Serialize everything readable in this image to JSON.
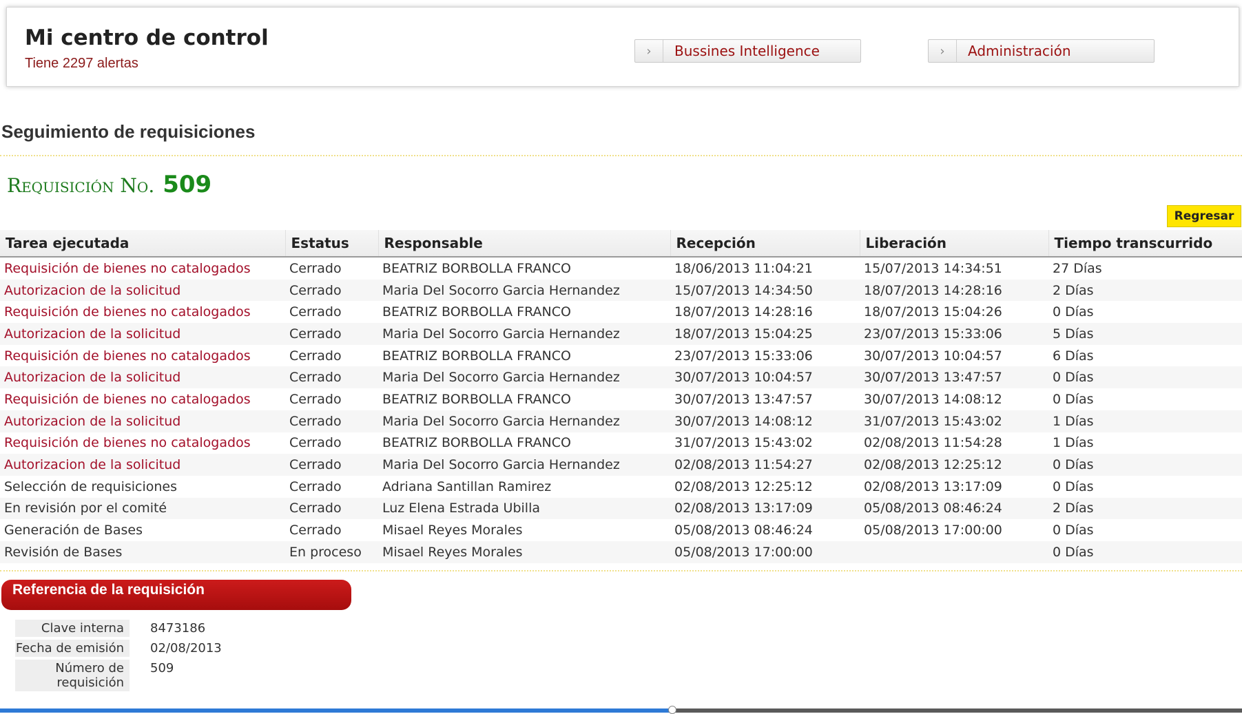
{
  "header": {
    "title": "Mi centro de control",
    "alerts": "Tiene 2297 alertas",
    "nav": [
      {
        "label": "Bussines Intelligence"
      },
      {
        "label": "Administración"
      }
    ]
  },
  "section": {
    "title": "Seguimiento de requisiciones"
  },
  "requisition": {
    "label": "Requisición No.",
    "number": "509",
    "back_label": "Regresar"
  },
  "table": {
    "columns": [
      "Tarea ejecutada",
      "Estatus",
      "Responsable",
      "Recepción",
      "Liberación",
      "Tiempo transcurrido"
    ],
    "rows": [
      {
        "task": "Requisición de bienes no catalogados",
        "link": true,
        "status": "Cerrado",
        "owner": "BEATRIZ BORBOLLA FRANCO",
        "received": "18/06/2013 11:04:21",
        "released": "15/07/2013 14:34:51",
        "elapsed": "27 Días"
      },
      {
        "task": "Autorizacion de la solicitud",
        "link": true,
        "status": "Cerrado",
        "owner": "Maria Del Socorro Garcia Hernandez",
        "received": "15/07/2013 14:34:50",
        "released": "18/07/2013 14:28:16",
        "elapsed": "2 Días"
      },
      {
        "task": "Requisición de bienes no catalogados",
        "link": true,
        "status": "Cerrado",
        "owner": "BEATRIZ BORBOLLA FRANCO",
        "received": "18/07/2013 14:28:16",
        "released": "18/07/2013 15:04:26",
        "elapsed": "0 Días"
      },
      {
        "task": "Autorizacion de la solicitud",
        "link": true,
        "status": "Cerrado",
        "owner": "Maria Del Socorro Garcia Hernandez",
        "received": "18/07/2013 15:04:25",
        "released": "23/07/2013 15:33:06",
        "elapsed": "5 Días"
      },
      {
        "task": "Requisición de bienes no catalogados",
        "link": true,
        "status": "Cerrado",
        "owner": "BEATRIZ BORBOLLA FRANCO",
        "received": "23/07/2013 15:33:06",
        "released": "30/07/2013 10:04:57",
        "elapsed": "6 Días"
      },
      {
        "task": "Autorizacion de la solicitud",
        "link": true,
        "status": "Cerrado",
        "owner": "Maria Del Socorro Garcia Hernandez",
        "received": "30/07/2013 10:04:57",
        "released": "30/07/2013 13:47:57",
        "elapsed": "0 Días"
      },
      {
        "task": "Requisición de bienes no catalogados",
        "link": true,
        "status": "Cerrado",
        "owner": "BEATRIZ BORBOLLA FRANCO",
        "received": "30/07/2013 13:47:57",
        "released": "30/07/2013 14:08:12",
        "elapsed": "0 Días"
      },
      {
        "task": "Autorizacion de la solicitud",
        "link": true,
        "status": "Cerrado",
        "owner": "Maria Del Socorro Garcia Hernandez",
        "received": "30/07/2013 14:08:12",
        "released": "31/07/2013 15:43:02",
        "elapsed": "1 Días"
      },
      {
        "task": "Requisición de bienes no catalogados",
        "link": true,
        "status": "Cerrado",
        "owner": "BEATRIZ BORBOLLA FRANCO",
        "received": "31/07/2013 15:43:02",
        "released": "02/08/2013 11:54:28",
        "elapsed": "1 Días"
      },
      {
        "task": "Autorizacion de la solicitud",
        "link": true,
        "status": "Cerrado",
        "owner": "Maria Del Socorro Garcia Hernandez",
        "received": "02/08/2013 11:54:27",
        "released": "02/08/2013 12:25:12",
        "elapsed": "0 Días"
      },
      {
        "task": "Selección de requisiciones",
        "link": false,
        "status": "Cerrado",
        "owner": "Adriana Santillan Ramirez",
        "received": "02/08/2013 12:25:12",
        "released": "02/08/2013 13:17:09",
        "elapsed": "0 Días"
      },
      {
        "task": "En revisión por el comité",
        "link": false,
        "status": "Cerrado",
        "owner": "Luz Elena Estrada Ubilla",
        "received": "02/08/2013 13:17:09",
        "released": "05/08/2013 08:46:24",
        "elapsed": "2 Días"
      },
      {
        "task": "Generación de Bases",
        "link": false,
        "status": "Cerrado",
        "owner": "Misael Reyes Morales",
        "received": "05/08/2013 08:46:24",
        "released": "05/08/2013 17:00:00",
        "elapsed": "0 Días"
      },
      {
        "task": "Revisión de Bases",
        "link": false,
        "status": "En proceso",
        "owner": "Misael Reyes Morales",
        "received": "05/08/2013 17:00:00",
        "released": "",
        "elapsed": "0 Días"
      }
    ]
  },
  "reference": {
    "title": "Referencia de la requisición",
    "fields": [
      {
        "key": "Clave interna",
        "value": "8473186"
      },
      {
        "key": "Fecha de emisión",
        "value": "02/08/2013"
      },
      {
        "key": "Número de requisición",
        "value": "509"
      }
    ]
  },
  "colors": {
    "link": "#a3102a",
    "accent_green": "#1a8a1a",
    "ref_header": "#b81212",
    "back_button": "#ffe500"
  },
  "icons": {
    "nav_arrow": "chevron-right-icon"
  }
}
